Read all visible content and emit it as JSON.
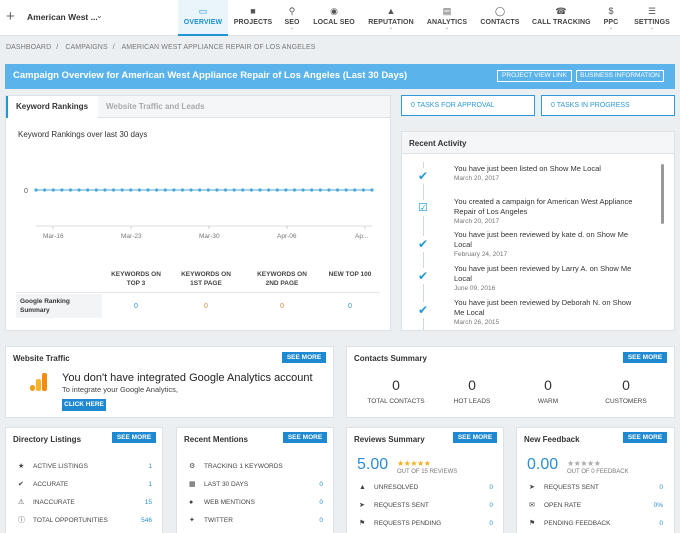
{
  "account": {
    "name": "American West ...",
    "add_icon": "plus-icon"
  },
  "nav": [
    {
      "label": "OVERVIEW",
      "icon": "book-icon",
      "active": true
    },
    {
      "label": "PROJECTS",
      "icon": "briefcase-icon"
    },
    {
      "label": "SEO",
      "icon": "search-icon"
    },
    {
      "label": "LOCAL SEO",
      "icon": "map-pin-icon"
    },
    {
      "label": "REPUTATION",
      "icon": "megaphone-icon"
    },
    {
      "label": "ANALYTICS",
      "icon": "bar-chart-icon"
    },
    {
      "label": "CONTACTS",
      "icon": "contacts-icon"
    },
    {
      "label": "CALL TRACKING",
      "icon": "phone-icon"
    },
    {
      "label": "PPC",
      "icon": "dollar-icon"
    },
    {
      "label": "SETTINGS",
      "icon": "sliders-icon"
    }
  ],
  "breadcrumb": [
    "DASHBOARD",
    "CAMPAIGNS",
    "AMERICAN WEST APPLIANCE REPAIR OF LOS ANGELES"
  ],
  "banner": {
    "title": "Campaign Overview for American West Appliance Repair of Los Angeles (Last 30 Days)",
    "btn_project": "PROJECT VIEW LINK",
    "btn_business": "BUSINESS INFORMATION",
    "color": "#5bb3eb"
  },
  "tasks": {
    "approval": "0  TASKS FOR APPROVAL",
    "progress": "0  TASKS IN PROGRESS"
  },
  "rankings": {
    "tab_active": "Keyword Rankings",
    "tab_inactive": "Website Traffic and Leads",
    "chart_title": "Keyword Rankings over last 30 days",
    "row_label": "Google Ranking Summary",
    "columns": [
      {
        "label": "KEYWORDS ON TOP 3",
        "value": "0",
        "color": "#2b8ed0"
      },
      {
        "label": "KEYWORDS ON 1ST PAGE",
        "value": "0",
        "color": "#e08a3c"
      },
      {
        "label": "KEYWORDS ON 2ND PAGE",
        "value": "0",
        "color": "#e08a3c"
      },
      {
        "label": "NEW TOP 100",
        "value": "0",
        "color": "#2b8ed0"
      }
    ]
  },
  "chart_data": {
    "type": "line",
    "title": "Keyword Rankings over last 30 days",
    "x_ticks": [
      "Mar-16",
      "Mar-23",
      "Mar-30",
      "Apr-06",
      "Ap..."
    ],
    "y_ticks": [
      "0"
    ],
    "series": [
      {
        "values": [
          0,
          0,
          0,
          0,
          0,
          0,
          0,
          0,
          0,
          0,
          0,
          0,
          0,
          0,
          0,
          0,
          0,
          0,
          0,
          0,
          0,
          0,
          0,
          0,
          0,
          0,
          0,
          0,
          0,
          0,
          0,
          0,
          0,
          0,
          0,
          0,
          0,
          0,
          0,
          0
        ]
      }
    ],
    "color": "#4aa8d8"
  },
  "activity": {
    "title": "Recent Activity",
    "items": [
      {
        "text": "You have just been listed on Show Me Local",
        "date": "March 20, 2017",
        "icon": "check-icon"
      },
      {
        "text": "You created a campaign for American West Appliance Repair of Los Angeles",
        "date": "March 20, 2017",
        "icon": "checkbox-icon"
      },
      {
        "text": "You have just been reviewed by kate d. on Show Me Local",
        "date": "February 24, 2017",
        "icon": "check-icon"
      },
      {
        "text": "You have just been reviewed by Larry A. on Show Me Local",
        "date": "June 09, 2016",
        "icon": "check-icon"
      },
      {
        "text": "You have just been reviewed by Deborah N. on Show Me Local",
        "date": "March 26, 2015",
        "icon": "check-icon"
      }
    ]
  },
  "traffic": {
    "title": "Website Traffic",
    "see_more": "SEE MORE",
    "headline": "You don't have integrated Google Analytics account",
    "sub": "To integrate your Google Analytics,",
    "cta": "CLICK HERE"
  },
  "contacts": {
    "title": "Contacts Summary",
    "see_more": "SEE MORE",
    "stats": [
      {
        "value": "0",
        "label": "TOTAL CONTACTS"
      },
      {
        "value": "0",
        "label": "HOT LEADS"
      },
      {
        "value": "0",
        "label": "WARM"
      },
      {
        "value": "0",
        "label": "CUSTOMERS"
      }
    ]
  },
  "directory": {
    "title": "Directory Listings",
    "see_more": "SEE MORE",
    "rows": [
      {
        "icon": "star-icon",
        "label": "ACTIVE LISTINGS",
        "value": "1"
      },
      {
        "icon": "check-circle-icon",
        "label": "ACCURATE",
        "value": "1"
      },
      {
        "icon": "alert-icon",
        "label": "INACCURATE",
        "value": "15"
      },
      {
        "icon": "info-icon",
        "label": "TOTAL OPPORTUNITIES",
        "value": "546"
      }
    ]
  },
  "mentions": {
    "title": "Recent Mentions",
    "see_more": "SEE MORE",
    "rows": [
      {
        "icon": "gear-icon",
        "label": "TRACKING 1 KEYWORDS",
        "value": ""
      },
      {
        "icon": "calendar-icon",
        "label": "LAST 30 DAYS",
        "value": "0"
      },
      {
        "icon": "globe-icon",
        "label": "WEB MENTIONS",
        "value": "0"
      },
      {
        "icon": "twitter-icon",
        "label": "TWITTER",
        "value": "0"
      }
    ]
  },
  "reviews": {
    "title": "Reviews Summary",
    "see_more": "SEE MORE",
    "score": "5.00",
    "stars": 5,
    "out_of": "OUT OF 15 REVIEWS",
    "rows": [
      {
        "icon": "warning-icon",
        "label": "UNRESOLVED",
        "value": "0"
      },
      {
        "icon": "send-icon",
        "label": "REQUESTS SENT",
        "value": "0"
      },
      {
        "icon": "flag-icon",
        "label": "REQUESTS PENDING",
        "value": "0"
      }
    ],
    "star_color": "#f2b01e"
  },
  "feedback": {
    "title": "New Feedback",
    "see_more": "SEE MORE",
    "score": "0.00",
    "stars": 0,
    "out_of": "OUT OF 0 FEEDBACK",
    "rows": [
      {
        "icon": "send-icon",
        "label": "REQUESTS SENT",
        "value": "0"
      },
      {
        "icon": "envelope-icon",
        "label": "OPEN RATE",
        "value": "0%"
      },
      {
        "icon": "flag-icon",
        "label": "PENDING FEEDBACK",
        "value": "0"
      }
    ]
  }
}
